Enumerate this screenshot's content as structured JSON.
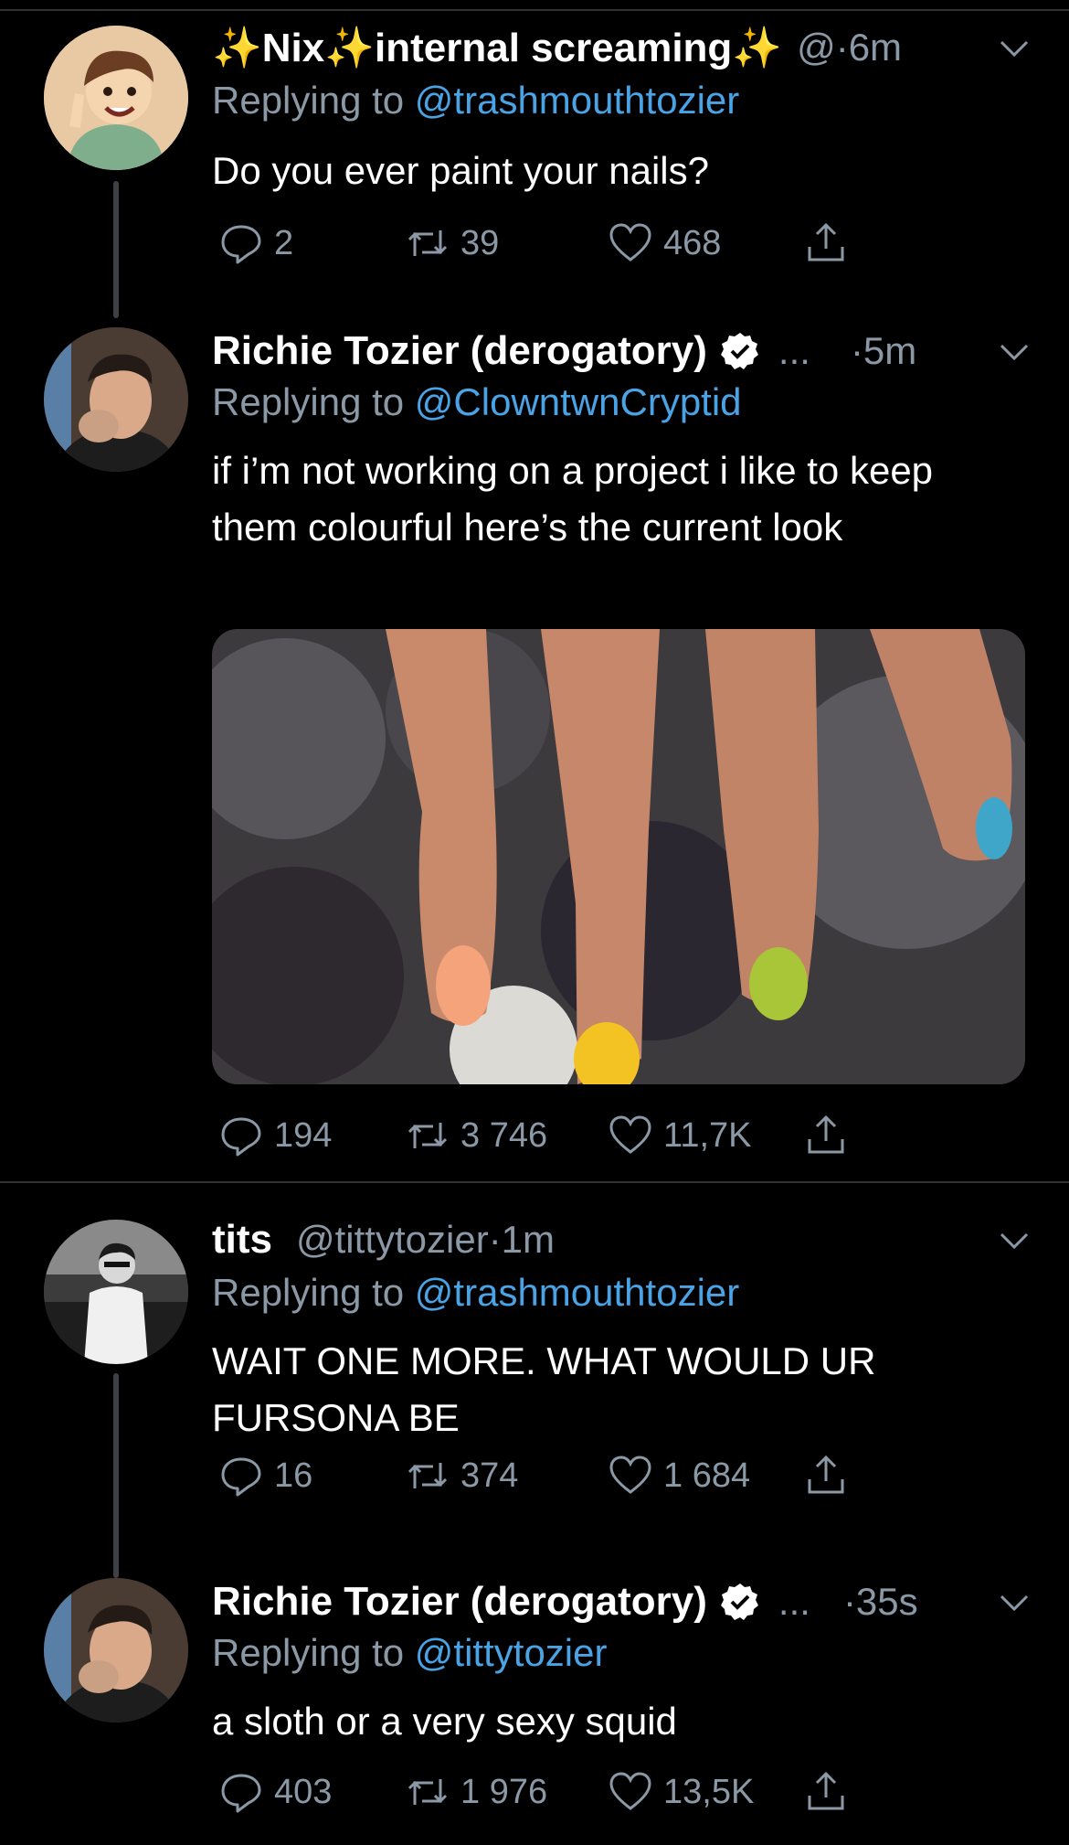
{
  "tweets": [
    {
      "display_name": "✨Nix✨internal screaming✨",
      "handle": "@·6m",
      "replying_label": "Replying to",
      "replying_to": "@trashmouthtozier",
      "text": "Do you ever paint your nails?",
      "stats": {
        "replies": "2",
        "retweets": "39",
        "likes": "468"
      }
    },
    {
      "display_name": "Richie Tozier (derogatory)",
      "ellipsis": "...",
      "time": "·5m",
      "replying_label": "Replying to",
      "replying_to": "@ClowntwnCryptid",
      "text": "if i’m not working on a project i like to keep them colourful here’s the current look",
      "stats": {
        "replies": "194",
        "retweets": "3 746",
        "likes": "11,7K"
      }
    },
    {
      "display_name": "tits",
      "handle": "@tittytozier",
      "time": "·1m",
      "replying_label": "Replying to",
      "replying_to": "@trashmouthtozier",
      "text": "WAIT ONE MORE. WHAT WOULD UR FURSONA BE",
      "stats": {
        "replies": "16",
        "retweets": "374",
        "likes": "1 684"
      }
    },
    {
      "display_name": "Richie Tozier (derogatory)",
      "ellipsis": "...",
      "time": "·35s",
      "replying_label": "Replying to",
      "replying_to": "@tittytozier",
      "text": "a sloth or a very sexy squid",
      "stats": {
        "replies": "403",
        "retweets": "1 976",
        "likes": "13,5K"
      }
    }
  ],
  "colors": {
    "background": "#000000",
    "link": "#4aa3e4",
    "muted": "#8b98a5",
    "divider": "#2f3336"
  }
}
